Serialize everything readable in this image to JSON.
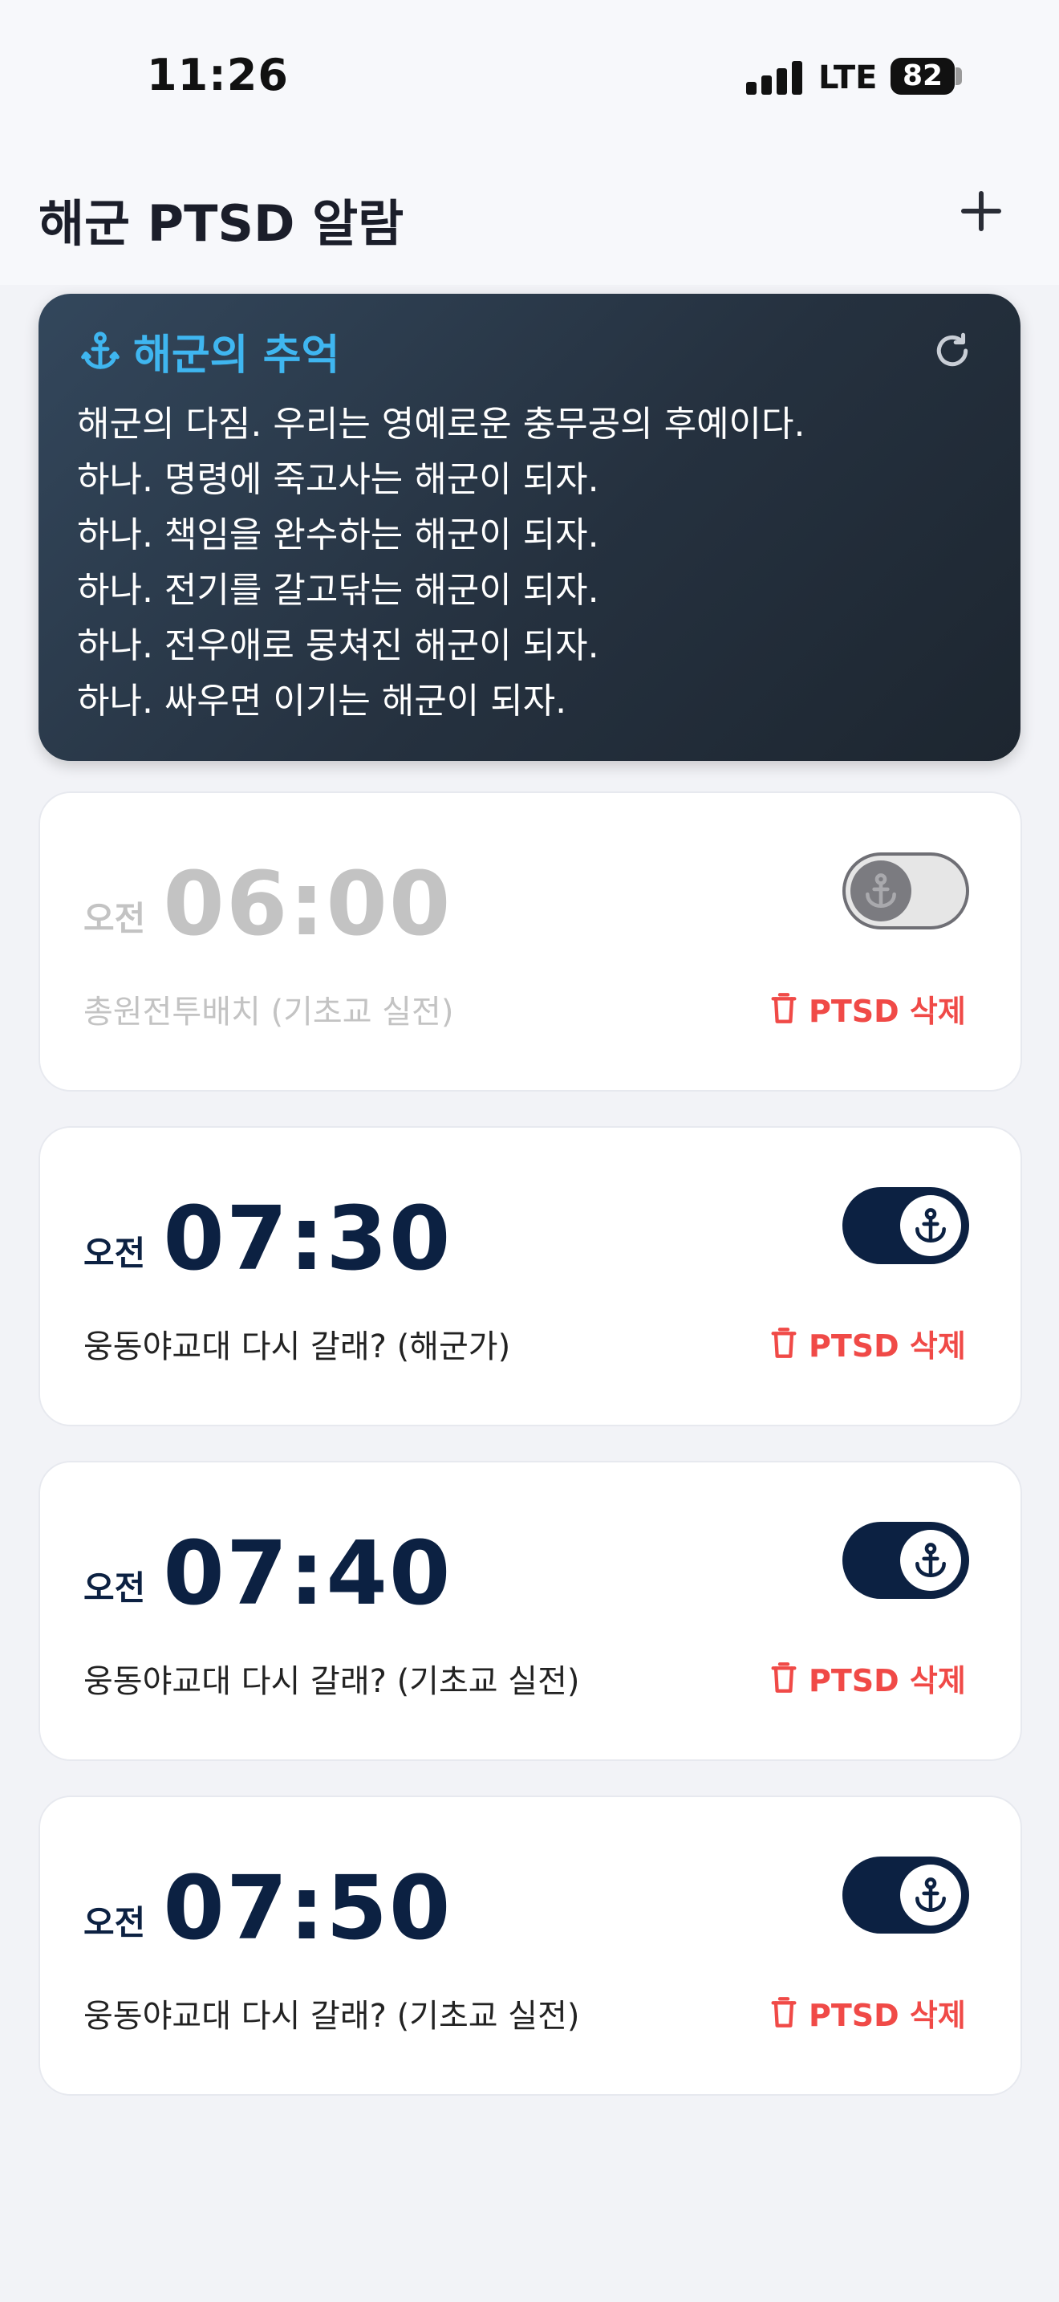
{
  "status_bar": {
    "time": "11:26",
    "network": "LTE",
    "battery": "82"
  },
  "header": {
    "title": "해군 PTSD 알람",
    "add_icon": "plus-icon"
  },
  "memory": {
    "title": "해군의 추억",
    "icon": "anchor-icon",
    "refresh_icon": "refresh-icon",
    "lines": [
      "해군의 다짐. 우리는 영예로운 충무공의 후예이다.",
      "하나. 명령에 죽고사는 해군이 되자.",
      "하나. 책임을 완수하는 해군이 되자.",
      "하나. 전기를 갈고닦는 해군이 되자.",
      "하나. 전우애로 뭉쳐진 해군이 되자.",
      "하나. 싸우면 이기는 해군이 되자."
    ]
  },
  "alarms": [
    {
      "period": "오전",
      "time": "06:00",
      "label": "총원전투배치 (기초교 실전)",
      "enabled": false,
      "delete_label": "PTSD 삭제"
    },
    {
      "period": "오전",
      "time": "07:30",
      "label": "웅동야교대 다시 갈래? (해군가)",
      "enabled": true,
      "delete_label": "PTSD 삭제"
    },
    {
      "period": "오전",
      "time": "07:40",
      "label": "웅동야교대 다시 갈래? (기초교 실전)",
      "enabled": true,
      "delete_label": "PTSD 삭제"
    },
    {
      "period": "오전",
      "time": "07:50",
      "label": "웅동야교대 다시 갈래? (기초교 실전)",
      "enabled": true,
      "delete_label": "PTSD 삭제"
    }
  ],
  "colors": {
    "navy": "#0c2142",
    "accent_blue": "#3fb6f0",
    "delete_red": "#f04a47",
    "disabled_gray": "#c3c3c3"
  }
}
